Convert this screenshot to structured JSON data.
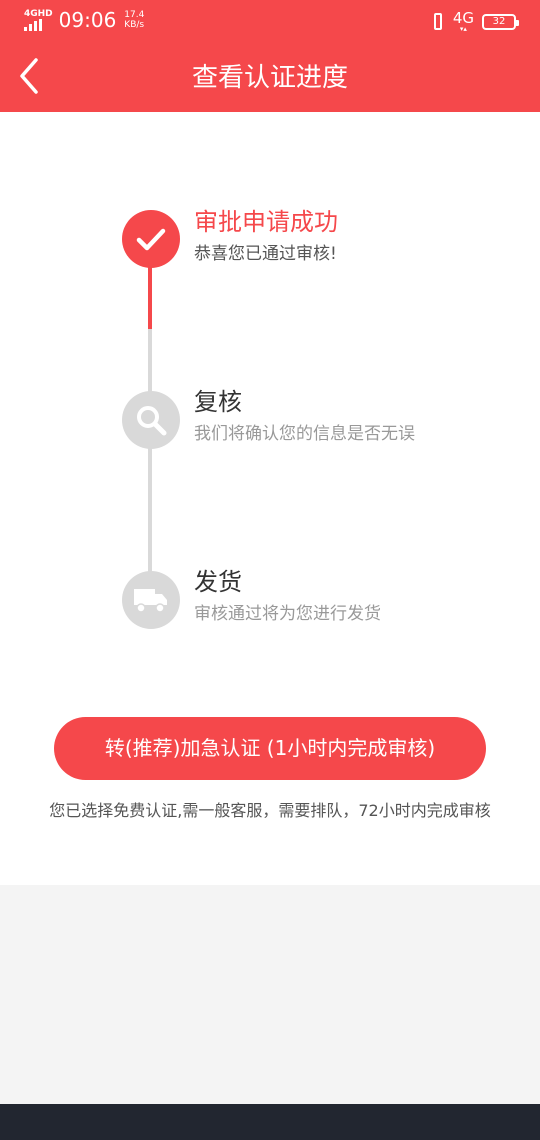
{
  "status_bar": {
    "network_small": "4GHD",
    "time": "09:06",
    "speed_value": "17.4",
    "speed_unit": "KB/s",
    "network": "4G",
    "battery": "32"
  },
  "header": {
    "title": "查看认证进度",
    "background": "#f5484b"
  },
  "steps": [
    {
      "title": "审批申请成功",
      "desc": "恭喜您已通过审核!",
      "status": "done",
      "icon": "check-icon"
    },
    {
      "title": "复核",
      "desc": "我们将确认您的信息是否无误",
      "status": "pending",
      "icon": "search-icon"
    },
    {
      "title": "发货",
      "desc": "审核通过将为您进行发货",
      "status": "pending",
      "icon": "truck-icon"
    }
  ],
  "urgent_button": "转(推荐)加急认证 (1小时内完成审核)",
  "note": "您已选择免费认证,需一般客服，需要排队，72小时内完成审核",
  "colors": {
    "accent": "#f5484b",
    "inactive": "#d9d9d9"
  }
}
